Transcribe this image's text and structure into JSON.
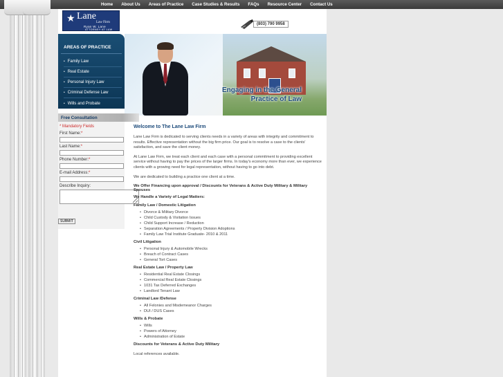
{
  "top_nav": [
    "Home",
    "About Us",
    "Areas of Practice",
    "Case Studies & Results",
    "FAQs",
    "Resource Center",
    "Contact Us"
  ],
  "logo": {
    "name": "Lane",
    "firm": "Law Firm",
    "person": "Ryan W. Lane",
    "subtitle": "ATTORNEY AT LAW"
  },
  "phone": "(803) 790 9958",
  "areas": {
    "title": "AREAS OF PRACTICE",
    "items": [
      "Family Law",
      "Real Estate",
      "Personal Injury Law",
      "Criminal Defense Law",
      "Wills and Probate"
    ]
  },
  "hero": {
    "tagline_1": "Engaging in the General",
    "tagline_2": "Practice of Law"
  },
  "consultation": {
    "title": "Free Consultation",
    "mandatory": "* Mandatory Fields",
    "first_name": "First Name:",
    "last_name": "Last Name:",
    "phone": "Phone Number:",
    "email": "E-mail Address:",
    "inquiry": "Describe Inquiry:",
    "req": "*",
    "submit": "SUBMIT"
  },
  "content": {
    "title": "Welcome to The Lane Law Firm",
    "p1": "Lane Law Firm is dedicated to serving clients needs in a variety of areas with integrity and commitment to results. Effective representation without the big firm price. Our goal is to resolve a case to the clients' satisfaction, and save the client money.",
    "p2": "At Lane Law Firm, we treat each client and each case with a personal commitment to providing excellent service without having to pay the prices of the larger firms. In today's economy more than ever, we experience clients with a growing need for legal representation, without having to go into debt.",
    "p3": "We are dedicated to building a practice one client at a time.",
    "financing": "We Offer Financing upon approval / Discounts for Veterans & Active Duty Military & Military Spouses",
    "handle": "We Handle a Variety of Legal Matters:",
    "sections": [
      {
        "heading": "Family Law / Domestic Litigation",
        "items": [
          "Divorce & Military Divorce",
          "Child Custody & Visitation Issues",
          "Child Support Increase / Reduction",
          "Separation Agreements / Property Division Adoptions",
          "Family Law Trial Institute Graduate- 2010 & 2011"
        ]
      },
      {
        "heading": "Civil Litigation",
        "items": [
          "Personal Injury & Automobile Wrecks",
          "Breach of Contract Cases",
          "General Tort Cases"
        ]
      },
      {
        "heading": "Real Estate Law / Property Law",
        "items": [
          "Residential Real Estate Closings",
          "Commercial Real Estate Closings",
          "1031 Tax Deferred Exchanges",
          "Landlord Tenant Law"
        ]
      },
      {
        "heading": "Criminal Law /Defense",
        "items": [
          "All Felonies and Misdemeanor Charges",
          "DUI / DUS Cases"
        ]
      },
      {
        "heading": "Wills & Probate",
        "items": [
          "Wills",
          "Powers of Attorney",
          "Administration of Estate"
        ]
      }
    ],
    "discounts": "Discounts for Veterans & Active Duty Military",
    "local_refs": "Local references available."
  }
}
